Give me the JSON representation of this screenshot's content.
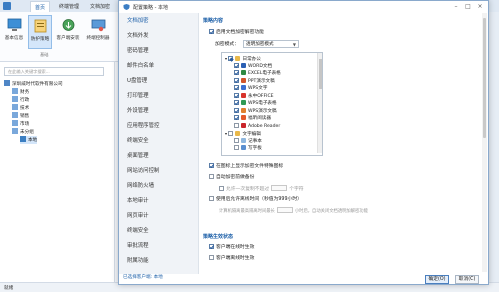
{
  "app": {
    "tabs": [
      "首页",
      "终端管理",
      "文档加密"
    ],
    "ribbon_buttons": [
      "基本信息",
      "防护策略",
      "客户端安装",
      "终端控制器"
    ],
    "ribbon_group": "基础",
    "search_placeholder": "在此输入关键字搜索...",
    "tree": [
      {
        "label": "深圳威时代软件有限公司",
        "level": 0
      },
      {
        "label": "财务",
        "level": 1
      },
      {
        "label": "行政",
        "level": 1
      },
      {
        "label": "技术",
        "level": 1
      },
      {
        "label": "销售",
        "level": 1
      },
      {
        "label": "市场",
        "level": 1
      },
      {
        "label": "未分组",
        "level": 1
      },
      {
        "label": "本地",
        "level": 2
      }
    ],
    "status_text": "就绪"
  },
  "dialog": {
    "title": "配置策略 - 本地",
    "nav_items": [
      "文档加密",
      "文档外发",
      "密码管理",
      "邮件白名单",
      "U盘管理",
      "打印管理",
      "外设管理",
      "应用程序管控",
      "终端安全",
      "桌面管理",
      "网站访问控制",
      "网络防火墙",
      "本地审计",
      "网页审计",
      "终端安全",
      "审批流程",
      "附属功能"
    ],
    "nav_footer": "已选择客户端: 本地",
    "section1_title": "策略内容",
    "enable_encrypt": "启用文档加密解密功能",
    "encrypt_mode_label": "加密模式：",
    "encrypt_mode_value": "透明加密模式",
    "file_tree": [
      {
        "label": "日常办公",
        "level": 0,
        "state": "part",
        "icon": "folder"
      },
      {
        "label": "WORD文档",
        "level": 1,
        "state": "on",
        "icon": "word"
      },
      {
        "label": "EXCEL电子表格",
        "level": 1,
        "state": "on",
        "icon": "excel"
      },
      {
        "label": "PPT演示文稿",
        "level": 1,
        "state": "on",
        "icon": "ppt"
      },
      {
        "label": "WPS文字",
        "level": 1,
        "state": "on",
        "icon": "wps-w"
      },
      {
        "label": "永中OFFICE",
        "level": 1,
        "state": "on",
        "icon": "yz"
      },
      {
        "label": "WPS电子表格",
        "level": 1,
        "state": "on",
        "icon": "wps-s"
      },
      {
        "label": "WPS演示文稿",
        "level": 1,
        "state": "on",
        "icon": "wps-p"
      },
      {
        "label": "福昕阅读器",
        "level": 1,
        "state": "on",
        "icon": "foxit"
      },
      {
        "label": "Adobe Reader",
        "level": 1,
        "state": "off",
        "icon": "adobe"
      },
      {
        "label": "文字编辑",
        "level": 0,
        "state": "off",
        "icon": "folder"
      },
      {
        "label": "记事本",
        "level": 1,
        "state": "off",
        "icon": "notepad"
      },
      {
        "label": "写字板",
        "level": 1,
        "state": "off",
        "icon": "wordpad"
      }
    ],
    "show_icon": "在图标上显示加密文件特殊图标",
    "auto_backup": "自动加密前做备份",
    "allow_unencrypt_prefix": "允许一次复制不超过",
    "allow_unencrypt_suffix": "个字符",
    "offline_enable": "使用后允许离线时间（秒值为999小时）",
    "offline_note_prefix": "计算机隔离最高隔离时间最长",
    "offline_note_suffix": "小时后，自动关闭文档透明加解密功能",
    "section2_title": "策略生效状态",
    "status_online": "客户端在线时生效",
    "status_offline": "客户端离线时生效",
    "ok_label": "确定(O)",
    "cancel_label": "取消(C)"
  },
  "colors": {
    "accent": "#1c5fa8",
    "ribbon_selected": "#d4e6fa",
    "nav_bg": "#f0f3f7"
  }
}
